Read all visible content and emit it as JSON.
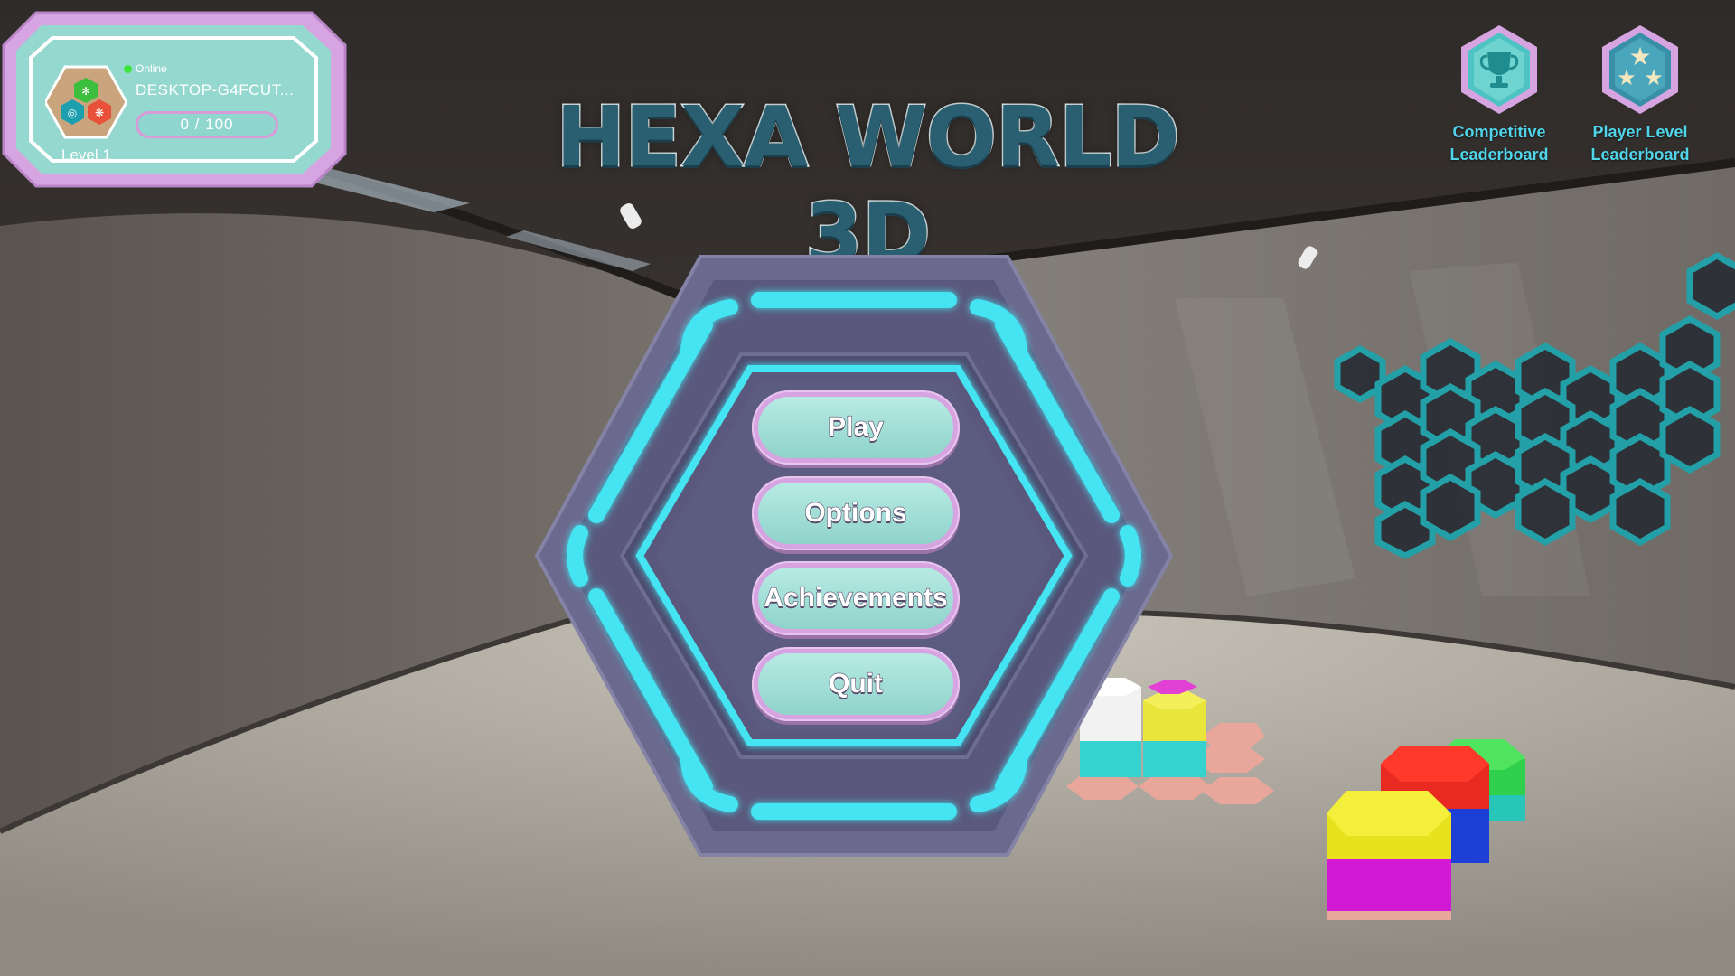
{
  "game": {
    "title": "HEXA WORLD 3D"
  },
  "player": {
    "status": "Online",
    "name": "DESKTOP-G4FCUT...",
    "xp_text": "0 / 100",
    "level": "Level 1"
  },
  "leaderboards": {
    "competitive": {
      "line1": "Competitive",
      "line2": "Leaderboard",
      "icon": "trophy-icon"
    },
    "player_level": {
      "line1": "Player Level",
      "line2": "Leaderboard",
      "icon": "three-stars-icon"
    }
  },
  "menu": {
    "play": "Play",
    "options": "Options",
    "achievements": "Achievements",
    "quit": "Quit"
  },
  "colors": {
    "accent_cyan": "#4fd4ea",
    "button_border": "#d6a4e0",
    "button_fill": "#8fd3cb",
    "title": "#2a5f72",
    "online": "#3ce43a"
  }
}
